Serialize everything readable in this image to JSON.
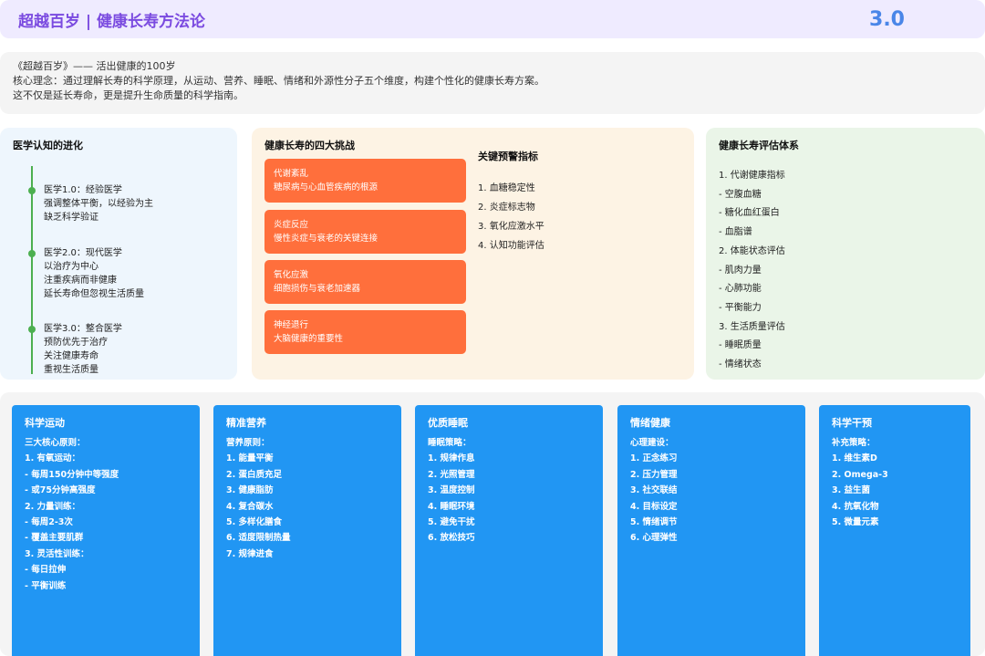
{
  "header": {
    "title": "超越百岁 | 健康长寿方法论",
    "version": "3.0"
  },
  "intro": {
    "line1": "《超越百岁》—— 活出健康的100岁",
    "line2": "核心理念：通过理解长寿的科学原理，从运动、营养、睡眠、情绪和外源性分子五个维度，构建个性化的健康长寿方案。",
    "line3": "这不仅是延长寿命，更是提升生命质量的科学指南。"
  },
  "evolution": {
    "title": "医学认知的进化",
    "items": [
      {
        "lines": [
          "医学1.0：经验医学",
          "强调整体平衡，以经验为主",
          "缺乏科学验证"
        ]
      },
      {
        "lines": [
          "医学2.0：现代医学",
          "以治疗为中心",
          "注重疾病而非健康",
          "延长寿命但忽视生活质量"
        ]
      },
      {
        "lines": [
          "医学3.0：整合医学",
          "预防优先于治疗",
          "关注健康寿命",
          "重视生活质量"
        ]
      }
    ]
  },
  "challenges": {
    "title": "健康长寿的四大挑战",
    "items": [
      {
        "name": "代谢紊乱",
        "desc": "糖尿病与心血管疾病的根源"
      },
      {
        "name": "炎症反应",
        "desc": "慢性炎症与衰老的关键连接"
      },
      {
        "name": "氧化应激",
        "desc": "细胞损伤与衰老加速器"
      },
      {
        "name": "神经退行",
        "desc": "大脑健康的重要性"
      }
    ],
    "warning_title": "关键预警指标",
    "warnings": [
      "1. 血糖稳定性",
      "2. 炎症标志物",
      "3. 氧化应激水平",
      "4. 认知功能评估"
    ]
  },
  "evaluation": {
    "title": "健康长寿评估体系",
    "items": [
      "1. 代谢健康指标",
      "- 空腹血糖",
      "- 糖化血红蛋白",
      "- 血脂谱",
      "2. 体能状态评估",
      "- 肌肉力量",
      "- 心肺功能",
      "- 平衡能力",
      "3. 生活质量评估",
      "- 睡眠质量",
      "- 情绪状态"
    ]
  },
  "cards": [
    {
      "title": "科学运动",
      "items": [
        "三大核心原则：",
        "1. 有氧运动：",
        "- 每周150分钟中等强度",
        "- 或75分钟高强度",
        "2. 力量训练：",
        "- 每周2-3次",
        "- 覆盖主要肌群",
        "3. 灵活性训练：",
        "- 每日拉伸",
        "- 平衡训练"
      ]
    },
    {
      "title": "精准营养",
      "items": [
        "营养原则：",
        "1. 能量平衡",
        "2. 蛋白质充足",
        "3. 健康脂肪",
        "4. 复合碳水",
        "5. 多样化膳食",
        "6. 适度限制热量",
        "7. 规律进食"
      ]
    },
    {
      "title": "优质睡眠",
      "items": [
        "睡眠策略：",
        "1. 规律作息",
        "2. 光照管理",
        "3. 温度控制",
        "4. 睡眠环境",
        "5. 避免干扰",
        "6. 放松技巧"
      ]
    },
    {
      "title": "情绪健康",
      "items": [
        "心理建设：",
        "1. 正念练习",
        "2. 压力管理",
        "3. 社交联结",
        "4. 目标设定",
        "5. 情绪调节",
        "6. 心理弹性"
      ]
    },
    {
      "title": "科学干预",
      "items": [
        "补充策略：",
        "1. 维生素D",
        "2. Omega-3",
        "3. 益生菌",
        "4. 抗氧化物",
        "5. 微量元素"
      ]
    }
  ]
}
